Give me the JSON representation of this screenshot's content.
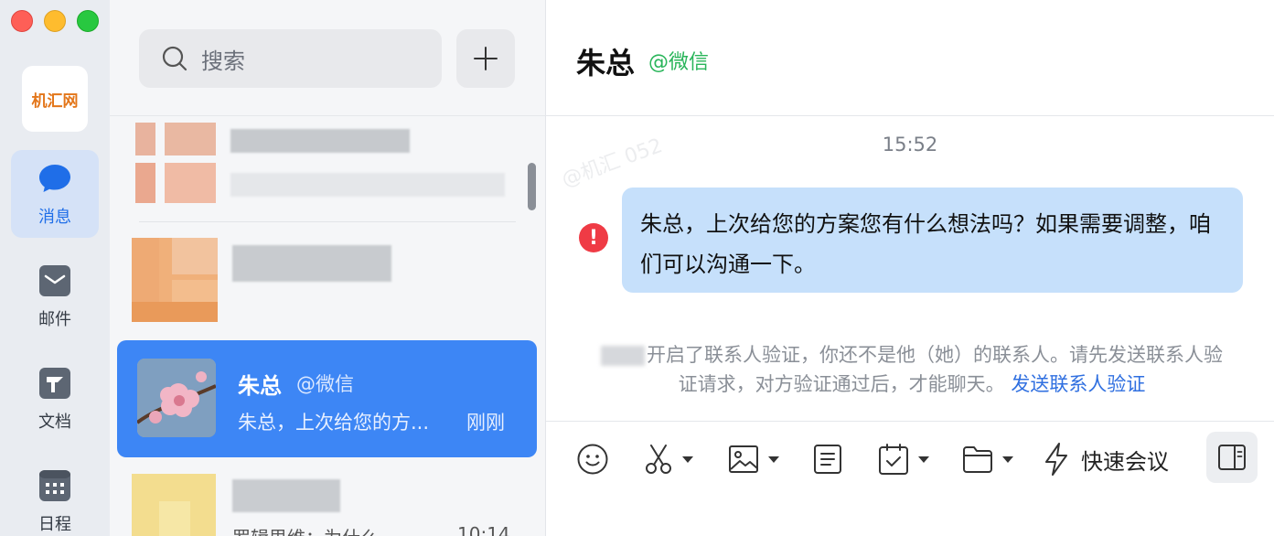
{
  "rail": {
    "logo_text": "机汇网",
    "nav": [
      {
        "label": "消息",
        "icon": "chat-bubble-icon",
        "active": true
      },
      {
        "label": "邮件",
        "icon": "mail-icon",
        "active": false
      },
      {
        "label": "文档",
        "icon": "document-icon",
        "active": false
      },
      {
        "label": "日程",
        "icon": "calendar-icon",
        "active": false
      }
    ]
  },
  "list": {
    "search_placeholder": "搜索",
    "add_icon": "plus-icon",
    "selected": {
      "name": "朱总",
      "tag": "@微信",
      "preview": "朱总，上次给您的方...",
      "time": "刚刚"
    },
    "bottom_item": {
      "preview": "罗辑思维：为什么",
      "time": "10:14"
    }
  },
  "chat": {
    "title": "朱总",
    "tag": "@微信",
    "timestamp": "15:52",
    "message": "朱总，上次给您的方案您有什么想法吗？如果需要调整，咱们可以沟通一下。",
    "notice_text": "开启了联系人验证，你还不是他（她）的联系人。请先发送联系人验证请求，对方验证通过后，才能聊天。",
    "notice_link": "发送联系人验证",
    "watermark": "@机汇 052",
    "toolbar": {
      "quick_meeting": "快速会议",
      "icons": [
        "emoji-icon",
        "scissors-icon",
        "image-icon",
        "note-icon",
        "task-icon",
        "folder-icon",
        "lightning-icon",
        "sidebar-toggle-icon"
      ]
    }
  },
  "colors": {
    "accent": "#3d86f5",
    "bubble": "#c6e0fb",
    "wechat_green": "#29b55a",
    "error": "#ef3b45",
    "link": "#2f6fe0"
  }
}
